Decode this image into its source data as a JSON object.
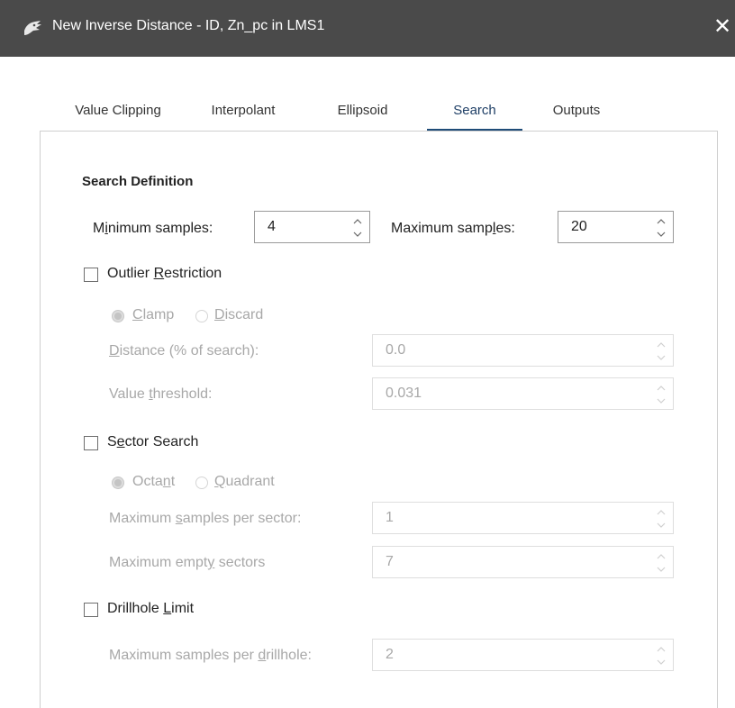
{
  "window": {
    "title": "New Inverse Distance - ID, Zn_pc in LMS1",
    "close_glyph": "✕"
  },
  "tabs": [
    {
      "label": "Value Clipping",
      "active": false
    },
    {
      "label": "Interpolant",
      "active": false
    },
    {
      "label": "Ellipsoid",
      "active": false
    },
    {
      "label": "Search",
      "active": true
    },
    {
      "label": "Outputs",
      "active": false
    }
  ],
  "search": {
    "section_title": "Search Definition",
    "min_samples": {
      "label_pre": "M",
      "label_ul": "i",
      "label_post": "nimum samples:",
      "value": "4"
    },
    "max_samples": {
      "label_pre": "Maximum samp",
      "label_ul": "l",
      "label_post": "es:",
      "value": "20"
    },
    "outlier": {
      "checkbox": {
        "label_pre": "Outlier ",
        "label_ul": "R",
        "label_post": "estriction",
        "checked": false
      },
      "clamp": {
        "label_ul": "C",
        "label_post": "lamp",
        "checked": true
      },
      "discard": {
        "label_ul": "D",
        "label_post": "iscard",
        "checked": false
      },
      "distance": {
        "label_ul": "D",
        "label_post": "istance (% of search):",
        "value": "0.0"
      },
      "threshold": {
        "label_pre": "Value ",
        "label_ul": "t",
        "label_post": "hreshold:",
        "value": "0.031"
      }
    },
    "sector": {
      "checkbox": {
        "label_pre": "S",
        "label_ul": "e",
        "label_post": "ctor Search",
        "checked": false
      },
      "octant": {
        "label_pre": "Octa",
        "label_ul": "n",
        "label_post": "t",
        "checked": true
      },
      "quadrant": {
        "label_ul": "Q",
        "label_post": "uadrant",
        "checked": false
      },
      "per_sector": {
        "label_pre": "Maximum ",
        "label_ul": "s",
        "label_post": "amples per sector:",
        "value": "1"
      },
      "empty": {
        "label_pre": "Maximum empt",
        "label_ul": "y",
        "label_post": " sectors",
        "value": "7"
      }
    },
    "drillhole": {
      "checkbox": {
        "label_pre": "Drillhole ",
        "label_ul": "L",
        "label_post": "imit",
        "checked": false
      },
      "per_drillhole": {
        "label_pre": "Maximum samples per ",
        "label_ul": "d",
        "label_post": "rillhole:",
        "value": "2"
      }
    }
  },
  "icons": {
    "app": "leapfrog-app-icon",
    "spin": "spin-arrows-icon"
  },
  "colors": {
    "titlebar": "#4a4a4a",
    "active_tab_underline": "#1f4c78",
    "disabled_text": "#a8a8a8"
  }
}
